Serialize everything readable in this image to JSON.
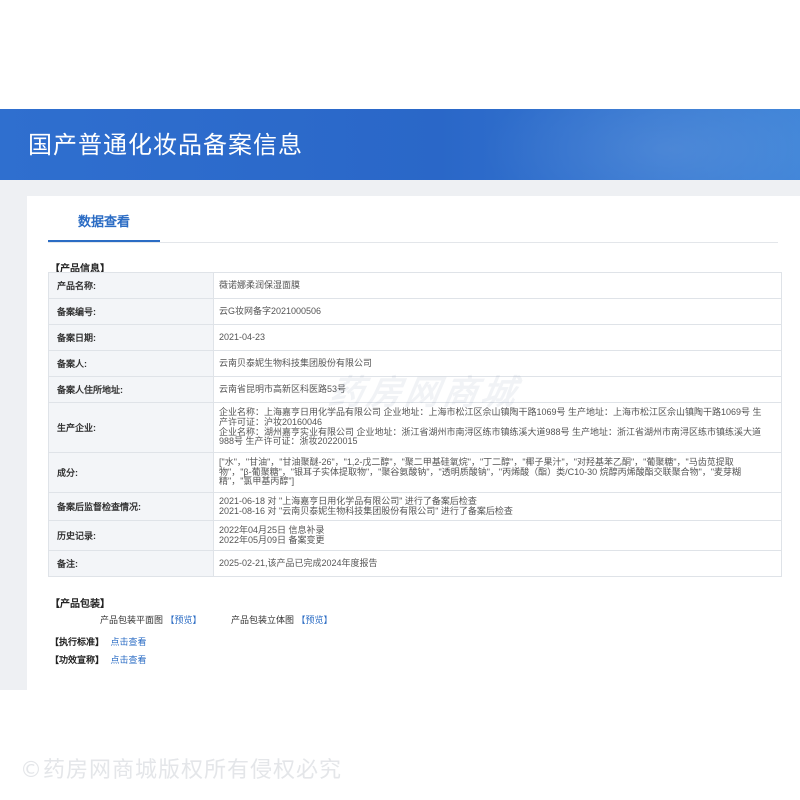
{
  "header": {
    "title": "国产普通化妆品备案信息"
  },
  "tabs": [
    {
      "label": "数据查看"
    }
  ],
  "product_info": {
    "section_title": "【产品信息】",
    "rows": [
      {
        "key": "产品名称:",
        "lines": [
          "薇诺娜柔润保湿面膜"
        ]
      },
      {
        "key": "备案编号:",
        "lines": [
          "云G妆网备字2021000506"
        ]
      },
      {
        "key": "备案日期:",
        "lines": [
          "2021-04-23"
        ]
      },
      {
        "key": "备案人:",
        "lines": [
          "云南贝泰妮生物科技集团股份有限公司"
        ]
      },
      {
        "key": "备案人住所地址:",
        "lines": [
          "云南省昆明市高新区科医路53号"
        ]
      },
      {
        "key": "生产企业:",
        "lines": [
          "企业名称：上海嘉亨日用化学品有限公司 企业地址：上海市松江区佘山镇陶干路1069号 生产地址：上海市松江区佘山镇陶干路1069号 生",
          "产许可证：沪妆20160046",
          "企业名称：湖州嘉亨实业有限公司 企业地址：浙江省湖州市南浔区练市镇练溪大道988号 生产地址：浙江省湖州市南浔区练市镇练溪大道",
          "988号 生产许可证：浙妆20220015"
        ]
      },
      {
        "key": "成分:",
        "lines": [
          "[\"水\"，\"甘油\"，\"甘油聚醚-26\"，\"1,2-戊二醇\"，\"聚二甲基硅氧烷\"，\"丁二醇\"，\"椰子果汁\"，\"对羟基苯乙酮\"，\"葡聚糖\"，\"马齿苋提取",
          "物\"，\"β-葡聚糖\"，\"银耳子实体提取物\"，\"聚谷氨酸钠\"，\"透明质酸钠\"，\"丙烯酸（酯）类/C10-30 烷醇丙烯酸酯交联聚合物\"，\"麦芽糊",
          "精\"，\"氯甲基丙醇\"]"
        ]
      },
      {
        "key": "备案后监督检查情况:",
        "lines": [
          "2021-06-18 对 \"上海嘉亨日用化学品有限公司\" 进行了备案后检查",
          "2021-08-16 对 \"云南贝泰妮生物科技集团股份有限公司\" 进行了备案后检查"
        ]
      },
      {
        "key": "历史记录:",
        "lines": [
          "2022年04月25日 信息补录",
          "2022年05月09日 备案变更"
        ]
      },
      {
        "key": "备注:",
        "lines": [
          "2025-02-21,该产品已完成2024年度报告"
        ]
      }
    ]
  },
  "packaging": {
    "section_title": "【产品包装】",
    "flat_label": "产品包装平面图",
    "flat_link": "【预览】",
    "three_d_label": "产品包装立体图",
    "three_d_link": "【预览】"
  },
  "standard": {
    "label": "【执行标准】",
    "link": "点击查看"
  },
  "efficacy": {
    "label": "【功效宣称】",
    "link": "点击查看"
  },
  "watermark": "药房网商城",
  "copyright": "©药房网商城版权所有侵权必究",
  "colors": {
    "banner": "#2f6fcf",
    "accent": "#2b6cc4",
    "key_cell_bg": "#f3f5f8",
    "border": "#dfe3e8"
  }
}
